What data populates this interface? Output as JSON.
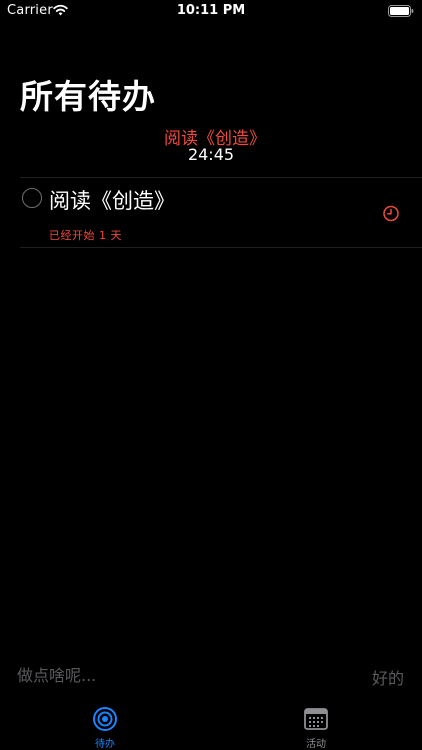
{
  "status_bar": {
    "carrier": "Carrier",
    "time": "10:11 PM"
  },
  "header": {
    "title": "所有待办"
  },
  "timer": {
    "task": "阅读《创造》",
    "countdown": "24:45"
  },
  "todos": [
    {
      "title": "阅读《创造》",
      "subtitle": "已经开始 1 天",
      "icon": "alarm-clock-icon"
    }
  ],
  "input_bar": {
    "placeholder": "做点啥呢...",
    "confirm_label": "好的"
  },
  "tab_bar": {
    "tabs": [
      {
        "label": "待办",
        "icon": "target-icon",
        "active": true
      },
      {
        "label": "活动",
        "icon": "calendar-icon",
        "active": false
      }
    ]
  },
  "colors": {
    "accent": "#1a84ff",
    "timer_red": "#ef4a3e",
    "background": "#000000"
  }
}
